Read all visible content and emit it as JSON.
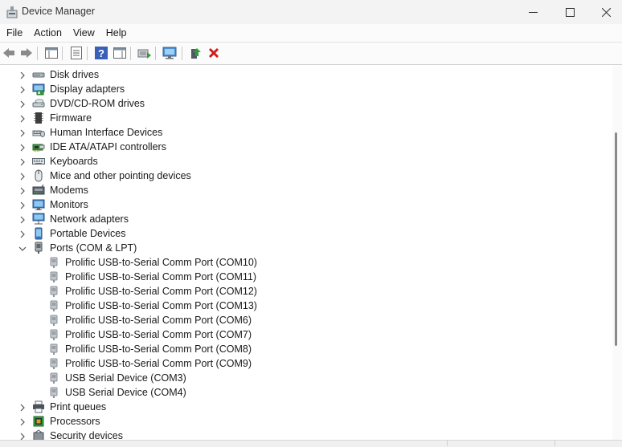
{
  "window": {
    "title": "Device Manager"
  },
  "menu": [
    "File",
    "Action",
    "View",
    "Help"
  ],
  "toolbar": {
    "buttons": [
      "back-arrow-icon",
      "forward-arrow-icon",
      "show-hide-console-tree-icon",
      "properties-icon",
      "help-icon",
      "action-pane-icon",
      "update-driver-icon",
      "scan-hardware-icon",
      "enable-device-icon",
      "uninstall-device-icon"
    ]
  },
  "tree": {
    "categories": [
      {
        "label": "Disk drives",
        "icon": "disk-drive-icon",
        "expanded": false
      },
      {
        "label": "Display adapters",
        "icon": "display-adapter-icon",
        "expanded": false
      },
      {
        "label": "DVD/CD-ROM drives",
        "icon": "dvd-drive-icon",
        "expanded": false
      },
      {
        "label": "Firmware",
        "icon": "firmware-icon",
        "expanded": false
      },
      {
        "label": "Human Interface Devices",
        "icon": "hid-icon",
        "expanded": false
      },
      {
        "label": "IDE ATA/ATAPI controllers",
        "icon": "ide-controller-icon",
        "expanded": false
      },
      {
        "label": "Keyboards",
        "icon": "keyboard-icon",
        "expanded": false
      },
      {
        "label": "Mice and other pointing devices",
        "icon": "mouse-icon",
        "expanded": false
      },
      {
        "label": "Modems",
        "icon": "modem-icon",
        "expanded": false
      },
      {
        "label": "Monitors",
        "icon": "monitor-icon",
        "expanded": false
      },
      {
        "label": "Network adapters",
        "icon": "network-adapter-icon",
        "expanded": false
      },
      {
        "label": "Portable Devices",
        "icon": "portable-device-icon",
        "expanded": false
      },
      {
        "label": "Ports (COM & LPT)",
        "icon": "port-icon",
        "expanded": true,
        "children": [
          "Prolific USB-to-Serial Comm Port (COM10)",
          "Prolific USB-to-Serial Comm Port (COM11)",
          "Prolific USB-to-Serial Comm Port (COM12)",
          "Prolific USB-to-Serial Comm Port (COM13)",
          "Prolific USB-to-Serial Comm Port (COM6)",
          "Prolific USB-to-Serial Comm Port (COM7)",
          "Prolific USB-to-Serial Comm Port (COM8)",
          "Prolific USB-to-Serial Comm Port (COM9)",
          "USB Serial Device (COM3)",
          "USB Serial Device (COM4)"
        ]
      },
      {
        "label": "Print queues",
        "icon": "printer-icon",
        "expanded": false
      },
      {
        "label": "Processors",
        "icon": "processor-icon",
        "expanded": false
      },
      {
        "label": "Security devices",
        "icon": "security-device-icon",
        "expanded": false
      }
    ]
  },
  "colors": {
    "accent": "#1f6fd0",
    "delete": "#d11a1a",
    "window_bg": "#f3f3f3"
  }
}
